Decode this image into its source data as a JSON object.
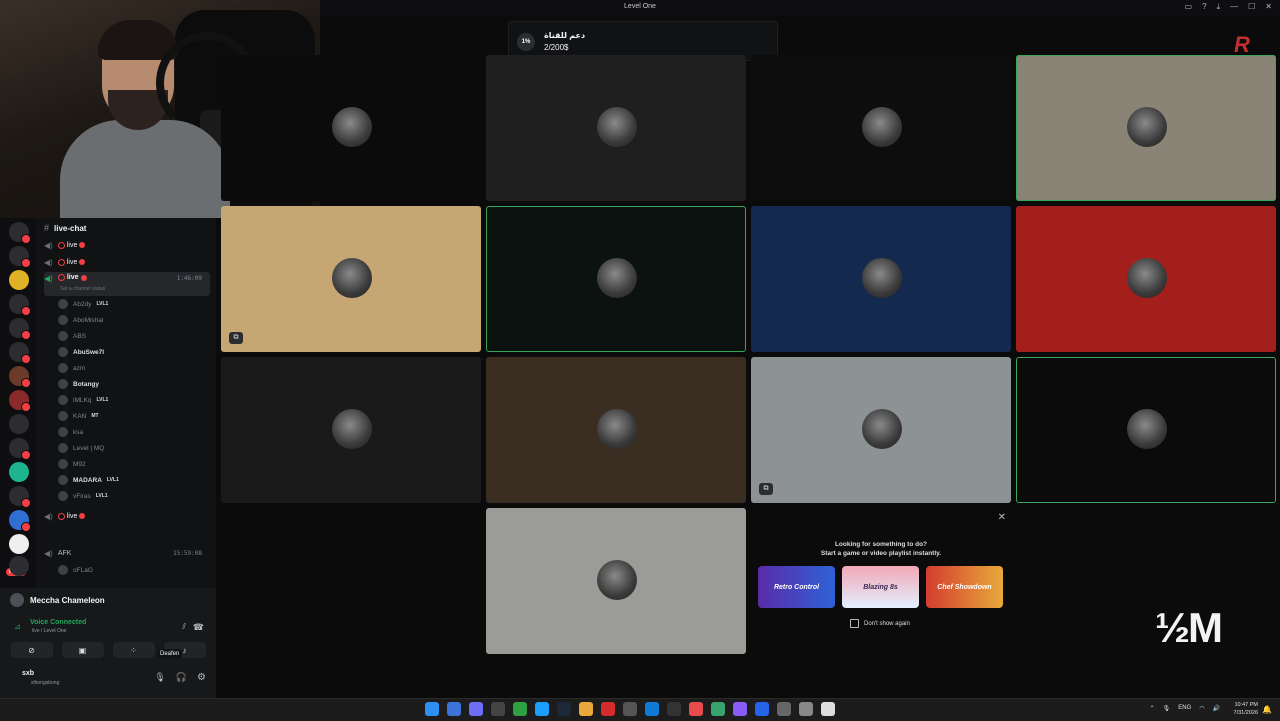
{
  "window": {
    "title": "Level One"
  },
  "window_controls": [
    "▭",
    "?",
    "⤓",
    "—",
    "☐",
    "✕"
  ],
  "support_goal": {
    "percent": "1%",
    "title": "دعم للقناة",
    "amount": "2/200$"
  },
  "channels": {
    "text_channel": "live-chat",
    "voice_label": "live",
    "current_time": "1:46:09",
    "status_hint": "Set a channel status",
    "afk_label": "AFK",
    "afk_time": "15:59:08",
    "members": [
      {
        "name": "Ab2dy",
        "tag": "LVL1",
        "hl": false
      },
      {
        "name": "AboMishal",
        "tag": "",
        "hl": false
      },
      {
        "name": "ABS",
        "tag": "",
        "hl": false
      },
      {
        "name": "AbuSwe7l",
        "tag": "",
        "hl": true
      },
      {
        "name": "azm",
        "tag": "",
        "hl": false
      },
      {
        "name": "Botangy",
        "tag": "",
        "hl": true
      },
      {
        "name": "iMLKq",
        "tag": "LVL1",
        "hl": false
      },
      {
        "name": "KAN",
        "tag": "MT",
        "hl": false
      },
      {
        "name": "ksa",
        "tag": "",
        "hl": false
      },
      {
        "name": "Level | MQ",
        "tag": "",
        "hl": false
      },
      {
        "name": "M92",
        "tag": "",
        "hl": false
      },
      {
        "name": "MADARA",
        "tag": "LVL1",
        "hl": true
      },
      {
        "name": "vFiras",
        "tag": "LVL1",
        "hl": false
      }
    ],
    "afk_member": "oFLaG"
  },
  "user_panel": {
    "activity_user": "Meccha Chameleon",
    "voice_status": "Voice Connected",
    "voice_channel": "live / Level One",
    "tooltip": "Deafen",
    "username": "sxb",
    "user_status": "slhongsbong"
  },
  "activity_card": {
    "line1": "Looking for something to do?",
    "line2": "Start a game or video playlist instantly.",
    "games": [
      "Retro Control",
      "Blazing 8s",
      "Chef Showdown"
    ],
    "dont_show": "Don't show again"
  },
  "overlay_text": "½M",
  "taskbar": {
    "lang": "ENG",
    "time": "10:47 PM",
    "date": "7/31/2026"
  },
  "colors": {
    "discord_bg": "#0b0b0c",
    "accent_green": "#23a55a",
    "live_red": "#f23f43",
    "tile_colors": [
      "#0b0b0c",
      "#1f1f20",
      "#0d0d0e",
      "#8a8476",
      "#c6a672",
      "#0b1210",
      "#14294e",
      "#a31f1c",
      "#1a1a1b",
      "#3a2d22",
      "#8d9294",
      "#0b0b0c",
      "#9b9c97"
    ]
  }
}
